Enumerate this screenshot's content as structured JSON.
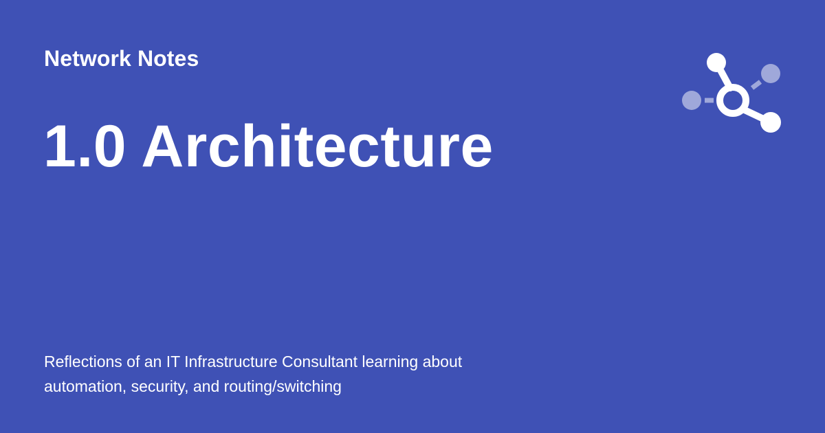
{
  "site": {
    "name": "Network Notes"
  },
  "page": {
    "title": "1.0 Architecture",
    "description": "Reflections of an IT Infrastructure Consultant learning about automation, security, and routing/switching"
  },
  "logo": {
    "icon": "network-hub-icon"
  },
  "colors": {
    "background": "#3f51b5",
    "text": "#ffffff",
    "logo_main": "#ffffff",
    "logo_faded": "#9fa8da"
  }
}
